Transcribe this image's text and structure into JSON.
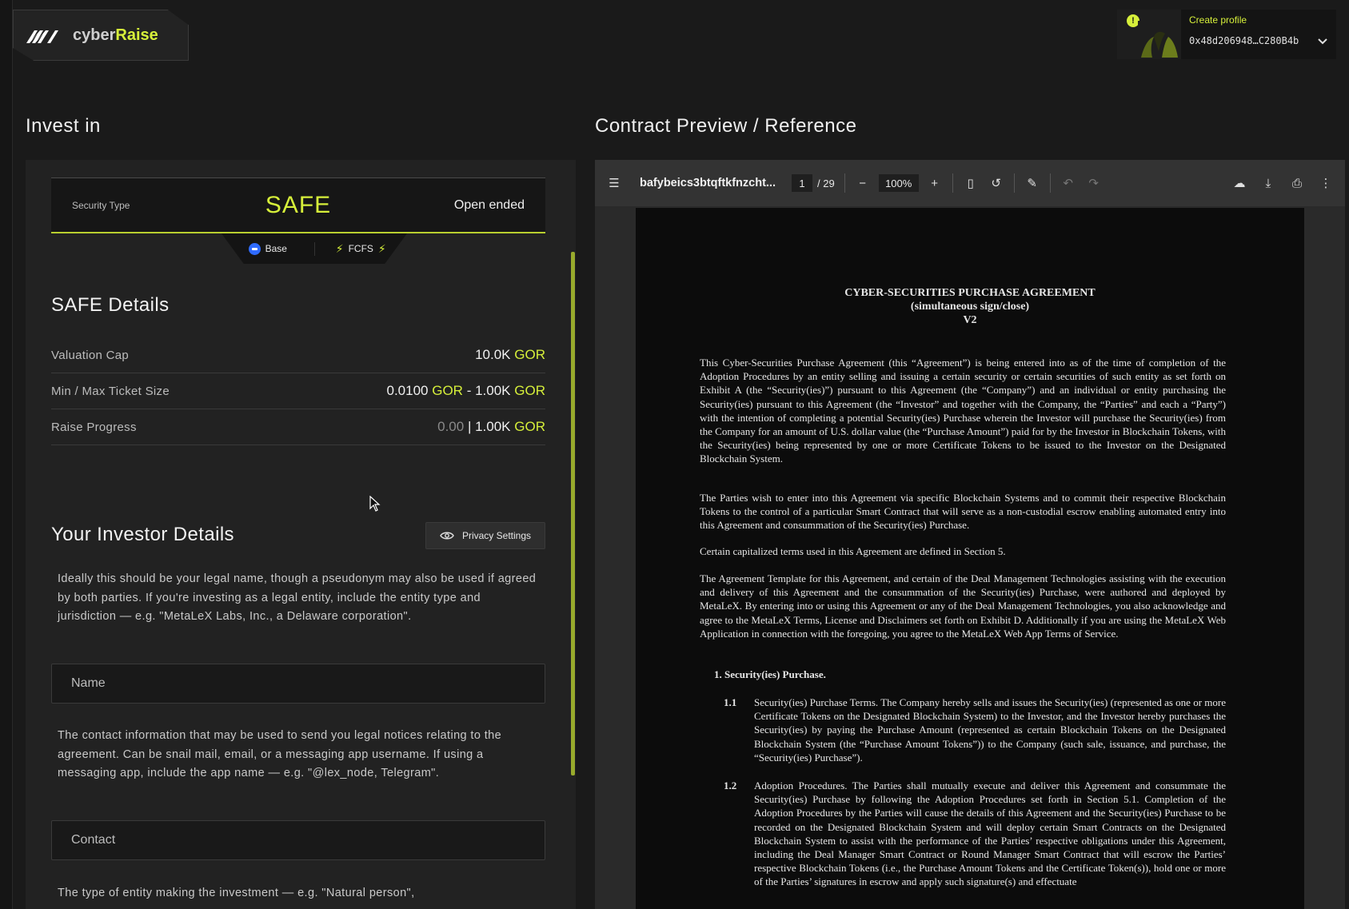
{
  "app": {
    "brand_prefix": "cyber",
    "brand_suffix": "Raise",
    "create_profile": "Create profile",
    "wallet_address": "0x48d206948…C280B4b",
    "notice_icon": "!"
  },
  "left": {
    "title": "Invest in",
    "security_type_label": "Security Type",
    "security_type_value": "SAFE",
    "security_term": "Open ended",
    "tag_base": "Base",
    "tag_fcfs": "FCFS",
    "safe_details_title": "SAFE Details",
    "valuation_cap_label": "Valuation Cap",
    "valuation_cap_value": "10.0K",
    "ticket_label": "Min / Max Ticket Size",
    "ticket_min": "0.0100",
    "ticket_max": "1.00K",
    "ticket_sep": "-",
    "raise_label": "Raise Progress",
    "raise_current": "0.00",
    "raise_sep": "|",
    "raise_target": "1.00K",
    "currency": "GOR",
    "investor_title": "Your Investor Details",
    "privacy_button": "Privacy Settings",
    "name_help": "Ideally this should be your legal name, though a pseudonym may also be used if agreed by both parties. If you're investing as a legal entity, include the entity type and jurisdiction — e.g. \"MetaLeX Labs, Inc., a Delaware corporation\".",
    "name_placeholder": "Name",
    "contact_help": "The contact information that may be used to send you legal notices relating to the agreement. Can be snail mail, email, or a messaging app username. If using a messaging app, include the app name — e.g. \"@lex_node, Telegram\".",
    "contact_placeholder": "Contact",
    "entity_help": "The type of entity making the investment — e.g. \"Natural person\","
  },
  "right": {
    "title": "Contract Preview / Reference",
    "file_name": "bafybeics3btqftkfnzcht...",
    "page_current": "1",
    "page_total": "/ 29",
    "zoom": "100%"
  },
  "document": {
    "title_line1": "CYBER-SECURITIES PURCHASE AGREEMENT",
    "title_line2": "(simultaneous sign/close)",
    "title_line3": "V2",
    "p1": "This Cyber-Securities Purchase Agreement (this “Agreement”) is being entered into as of the time of completion of the Adoption Procedures by an entity selling and issuing a certain security or certain securities of such entity as set forth on Exhibit A (the “Security(ies)”) pursuant to this Agreement (the “Company”) and an individual or entity purchasing the Security(ies) pursuant to this Agreement (the “Investor” and together with the Company, the “Parties” and each a “Party”) with the intention of completing a potential Security(ies) Purchase wherein the Investor will purchase the Security(ies) from the Company for an amount of U.S. dollar value (the “Purchase Amount”) paid for by the Investor in Blockchain Tokens, with the Security(ies) being represented by one or more Certificate Tokens to be issued to the Investor on the Designated Blockchain System.",
    "p2": "The Parties wish to enter into this Agreement via specific Blockchain Systems and to commit their respective Blockchain Tokens to the control of a particular Smart Contract that will serve as a non-custodial escrow enabling automated entry into this Agreement and consummation of the Security(ies) Purchase.",
    "p3": "Certain capitalized terms used in this Agreement are defined in Section 5.",
    "p4": "The Agreement Template for this Agreement, and certain of the Deal Management Technologies assisting with the execution and delivery of this Agreement and the consummation of the Security(ies) Purchase, were authored and deployed by MetaLeX. By entering into or using this Agreement or any of the Deal Management Technologies, you also acknowledge and agree to the MetaLeX Terms, License and Disclaimers set forth on Exhibit D. Additionally if you are using the MetaLeX Web Application in connection with the foregoing, you agree to the MetaLeX Web App Terms of Service.",
    "s1": "1.  Security(ies) Purchase.",
    "s11_num": "1.1",
    "s11_text": "Security(ies) Purchase Terms. The Company hereby sells and issues the Security(ies) (represented as one or more Certificate Tokens on the Designated Blockchain System) to the Investor, and the Investor hereby purchases the Security(ies) by paying the Purchase Amount (represented as certain Blockchain Tokens on the Designated Blockchain System (the “Purchase Amount Tokens”)) to the Company (such sale, issuance, and purchase, the “Security(ies) Purchase”).",
    "s12_num": "1.2",
    "s12_text": "Adoption Procedures. The Parties shall mutually execute and deliver this Agreement and consummate the Security(ies) Purchase by following the Adoption Procedures set forth in Section 5.1. Completion of the Adoption Procedures by the Parties will cause the details of this Agreement and the Security(ies) Purchase to be recorded on the Designated Blockchain System and will deploy certain Smart Contracts on the Designated Blockchain System to assist with the performance of the Parties’ respective obligations under this Agreement, including the Deal Manager Smart Contract or Round Manager Smart Contract that will escrow the Parties’ respective Blockchain Tokens (i.e., the Purchase Amount Tokens and the Certificate Token(s)), hold one or more of the Parties’ signatures in escrow and apply such signature(s) and effectuate"
  },
  "colors": {
    "accent": "#d6ef3a",
    "background": "#1a1a1a",
    "panel": "#222222",
    "base_chain": "#2f6bff"
  }
}
